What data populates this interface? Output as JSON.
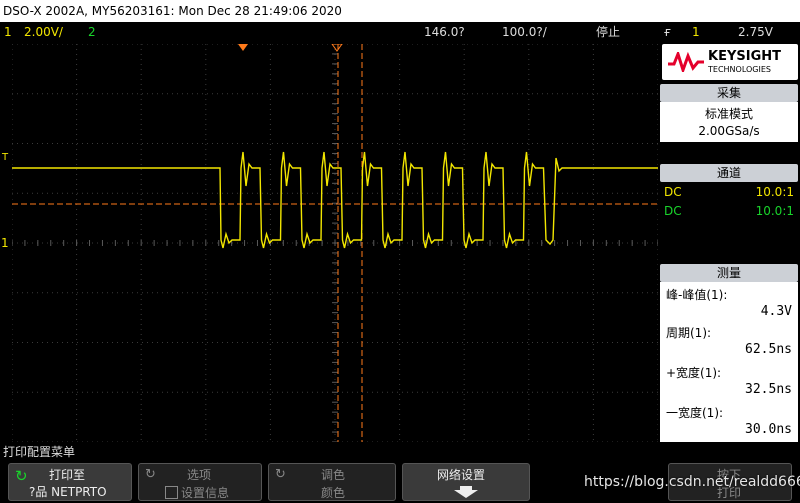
{
  "title": "DSO-X 2002A, MY56203161: Mon Dec 28 21:49:06 2020",
  "status": {
    "ch1_num": "1",
    "ch1_scale": "2.00V/",
    "ch2_num": "2",
    "delay": "146.0",
    "delay_unit_glyph": "?",
    "timebase": "100.0",
    "timebase_unit_glyph": "?/",
    "run_state": "停止",
    "trigger_slope_glyph": "ғ",
    "trigger_ch": "1",
    "trigger_level": "2.75V"
  },
  "panel": {
    "brand": "KEYSIGHT",
    "brand_sub": "TECHNOLOGIES",
    "acq_header": "采集",
    "acq_mode": "标准模式",
    "acq_rate": "2.00GSa/s",
    "channels_header": "通道",
    "channels": [
      {
        "coupling": "DC",
        "probe": "10.0:1",
        "color": "#f2e600"
      },
      {
        "coupling": "DC",
        "probe": "10.0:1",
        "color": "#19d42b"
      }
    ],
    "meas_header": "测量",
    "measurements": [
      {
        "label": "峰-峰值(1):",
        "value": "4.3V"
      },
      {
        "label": "周期(1):",
        "value": "62.5ns"
      },
      {
        "label": "+宽度(1):",
        "value": "32.5ns"
      },
      {
        "label": "一宽度(1):",
        "value": "30.0ns"
      }
    ]
  },
  "menu": {
    "title": "打印配置菜单",
    "softkeys": [
      {
        "line1": "打印至",
        "line2": "?品 NETPRTO"
      },
      {
        "line1": "选项",
        "line2": "设置信息"
      },
      {
        "line1": "调色",
        "line2": "颜色"
      },
      {
        "line1": "网络设置",
        "line2": ""
      },
      {
        "line1": "按下",
        "line2": "打印"
      }
    ]
  },
  "watermark": "https://blog.csdn.net/realdd666",
  "colors": {
    "ch1": "#f2e600",
    "ch2": "#19d42b",
    "cursor": "#ff7a1a"
  }
}
